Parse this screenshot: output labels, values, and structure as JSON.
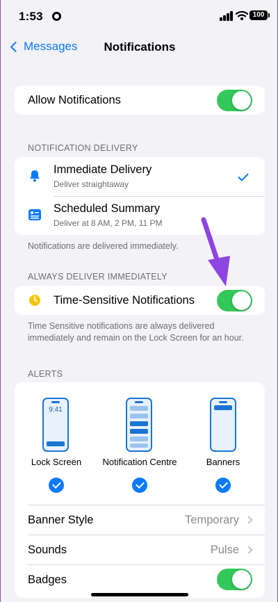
{
  "status": {
    "time": "1:53",
    "battery": "100"
  },
  "nav": {
    "back_label": "Messages",
    "title": "Notifications"
  },
  "allow": {
    "label": "Allow Notifications",
    "enabled": true
  },
  "delivery": {
    "header": "NOTIFICATION DELIVERY",
    "options": [
      {
        "title": "Immediate Delivery",
        "subtitle": "Deliver straightaway",
        "selected": true,
        "icon": "bell-icon"
      },
      {
        "title": "Scheduled Summary",
        "subtitle": "Deliver at 8 AM, 2 PM, 11 PM",
        "selected": false,
        "icon": "summary-icon"
      }
    ],
    "footer": "Notifications are delivered immediately."
  },
  "always": {
    "header": "ALWAYS DELIVER IMMEDIATELY",
    "label": "Time-Sensitive Notifications",
    "enabled": true,
    "footer": "Time Sensitive notifications are always delivered immediately and remain on the Lock Screen for an hour."
  },
  "alerts": {
    "header": "ALERTS",
    "styles": [
      {
        "label": "Lock Screen",
        "checked": true,
        "screen_text": "9:41"
      },
      {
        "label": "Notification Centre",
        "checked": true
      },
      {
        "label": "Banners",
        "checked": true
      }
    ],
    "banner_style": {
      "label": "Banner Style",
      "value": "Temporary"
    },
    "sounds": {
      "label": "Sounds",
      "value": "Pulse"
    },
    "badges": {
      "label": "Badges",
      "enabled": true
    }
  },
  "colors": {
    "accent": "#0a7aff",
    "toggle_on": "#34c759",
    "annotation_arrow": "#8e44e0"
  }
}
